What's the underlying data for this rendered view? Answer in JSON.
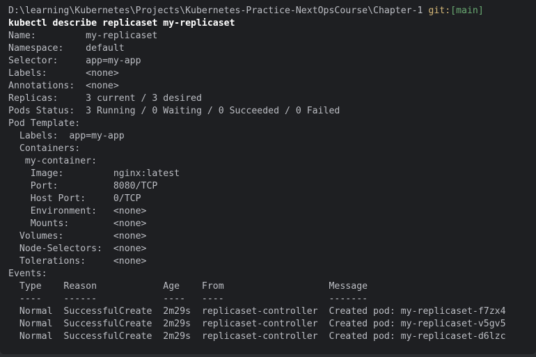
{
  "prompt": {
    "path": "D:\\learning\\Kubernetes\\Projects\\Kubernetes-Practice-NextOpsCourse\\Chapter-1 ",
    "git_label": "git:",
    "git_branch": "[main]"
  },
  "command": "kubectl describe replicaset my-replicaset",
  "output": [
    "Name:         my-replicaset",
    "Namespace:    default",
    "Selector:     app=my-app",
    "Labels:       <none>",
    "Annotations:  <none>",
    "Replicas:     3 current / 3 desired",
    "Pods Status:  3 Running / 0 Waiting / 0 Succeeded / 0 Failed",
    "Pod Template:",
    "  Labels:  app=my-app",
    "  Containers:",
    "   my-container:",
    "    Image:         nginx:latest",
    "    Port:          8080/TCP",
    "    Host Port:     0/TCP",
    "    Environment:   <none>",
    "    Mounts:        <none>",
    "  Volumes:         <none>",
    "  Node-Selectors:  <none>",
    "  Tolerations:     <none>",
    "Events:",
    "  Type    Reason            Age    From                   Message",
    "  ----    ------            ----   ----                   -------",
    "  Normal  SuccessfulCreate  2m29s  replicaset-controller  Created pod: my-replicaset-f7zx4",
    "  Normal  SuccessfulCreate  2m29s  replicaset-controller  Created pod: my-replicaset-v5gv5",
    "  Normal  SuccessfulCreate  2m29s  replicaset-controller  Created pod: my-replicaset-d6lzc"
  ]
}
